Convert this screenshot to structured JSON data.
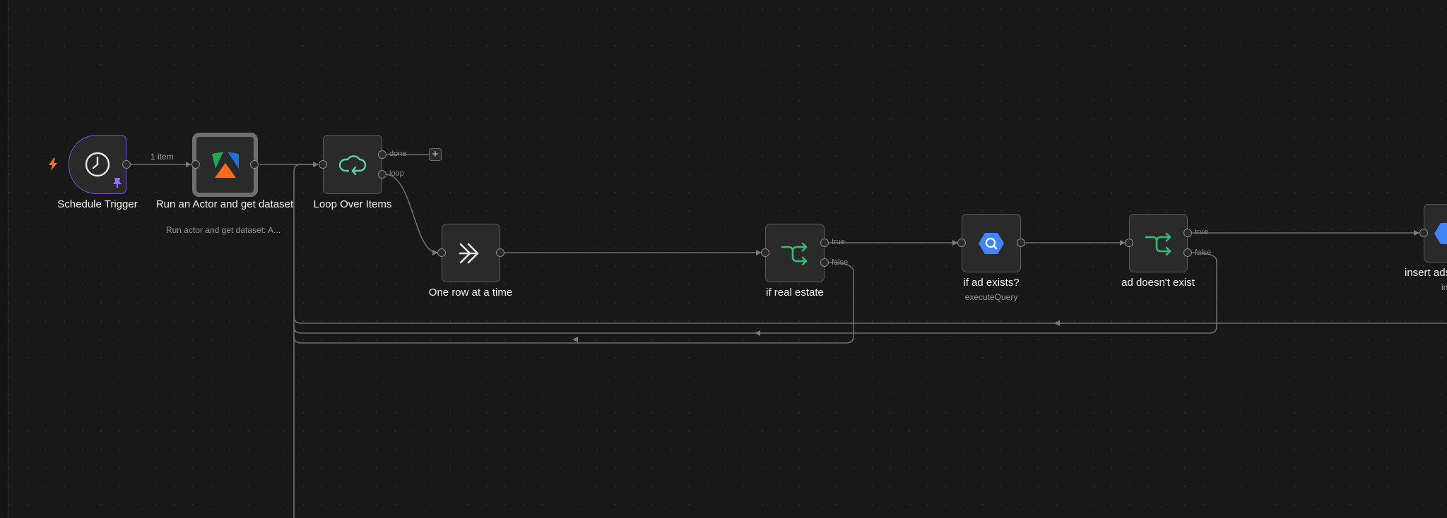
{
  "canvas": {
    "background": "#181818"
  },
  "nodes": {
    "schedule_trigger": {
      "label": "Schedule Trigger",
      "icon": "clock-icon"
    },
    "run_actor": {
      "label": "Run an Actor and get dataset",
      "subtitle": "Run actor and get dataset: A...",
      "icon": "apify-logo-icon"
    },
    "loop": {
      "label": "Loop Over Items",
      "icon": "loop-arrow-icon",
      "ports": {
        "done": "done",
        "loop": "loop"
      }
    },
    "one_row": {
      "label": "One row at a time",
      "icon": "double-chevron-right-icon"
    },
    "if_real_estate": {
      "label": "if real estate",
      "icon": "branch-arrows-icon",
      "ports": {
        "true": "true",
        "false": "false"
      }
    },
    "if_ad_exists": {
      "label": "if ad exists?",
      "subtitle": "executeQuery",
      "icon": "bigquery-icon"
    },
    "ad_doesnt_exist": {
      "label": "ad doesn't exist",
      "icon": "branch-arrows-icon",
      "ports": {
        "true": "true",
        "false": "false"
      }
    },
    "insert_ads": {
      "label": "insert ads",
      "subtitle": "in",
      "icon": "bigquery-icon"
    }
  },
  "edges": {
    "trigger_to_actor_label": "1 item"
  },
  "plus_symbol": "+",
  "colors": {
    "trigger_border": "#7b4fe0",
    "if_icon": "#2fbf71",
    "bigquery_blue": "#4285f4",
    "bolt": "#ff6d2d"
  }
}
